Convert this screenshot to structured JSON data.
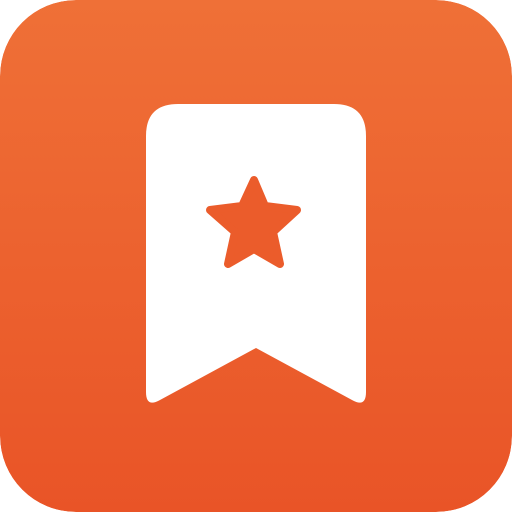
{
  "icon": {
    "name": "bookmark-star-icon",
    "glyph_icon": "star-icon",
    "colors": {
      "gradient_top": "#EF7037",
      "gradient_bottom": "#E95427",
      "bookmark": "#FFFFFF",
      "star": "#EB5C2B"
    }
  }
}
